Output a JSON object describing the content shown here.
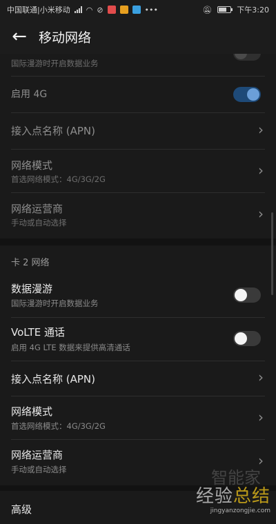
{
  "status_bar": {
    "carrier": "中国联通|小米移动",
    "time": "下午3:20"
  },
  "header": {
    "title": "移动网络"
  },
  "card1": {
    "roaming_subtitle": "国际漫游时开启数据业务",
    "enable4g_label": "启用 4G",
    "apn_label": "接入点名称 (APN)",
    "network_mode_label": "网络模式",
    "network_mode_value": "首选网络模式：4G/3G/2G",
    "operator_label": "网络运营商",
    "operator_value": "手动或自动选择"
  },
  "card2": {
    "section_title": "卡 2 网络",
    "roaming_label": "数据漫游",
    "roaming_subtitle": "国际漫游时开启数据业务",
    "volte_label": "VoLTE 通话",
    "volte_subtitle": "启用 4G LTE 数据来提供高清通话",
    "apn_label": "接入点名称 (APN)",
    "network_mode_label": "网络模式",
    "network_mode_value": "首选网络模式：4G/3G/2G",
    "operator_label": "网络运营商",
    "operator_value": "手动或自动选择"
  },
  "advanced": {
    "label": "高级"
  },
  "toggles": {
    "card1_roaming": false,
    "card1_enable4g": true,
    "card2_roaming": false,
    "card2_volte": false
  },
  "watermark": {
    "top_text": "智能家",
    "main_text_a": "经验",
    "main_text_b": "总结",
    "url": "jingyanzongjie.com"
  },
  "colors": {
    "accent_toggle": "#6b9fd8",
    "background": "#1a1a1a"
  }
}
